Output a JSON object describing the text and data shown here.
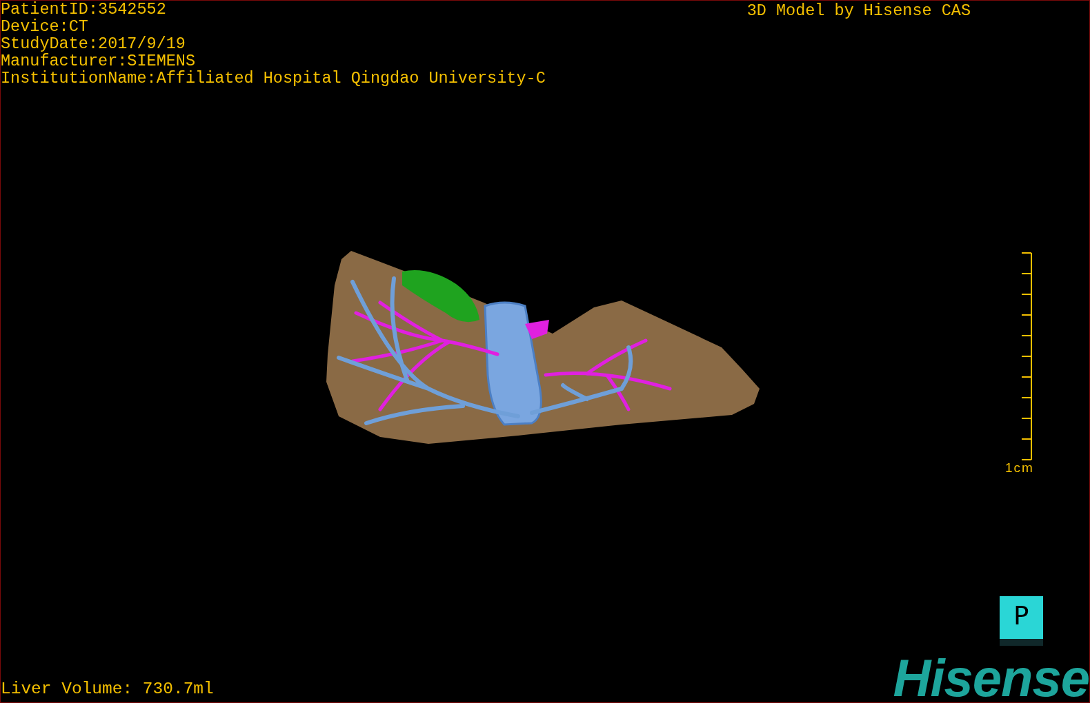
{
  "overlay": {
    "info_lines": [
      "PatientID:3542552",
      "Device:CT",
      "StudyDate:2017/9/19",
      "Manufacturer:SIEMENS",
      "InstitutionName:Affiliated Hospital Qingdao University-C"
    ],
    "title": "3D Model by Hisense CAS"
  },
  "scale_bar": {
    "label": "1cm"
  },
  "orientation_cube": {
    "label": "P"
  },
  "measurement": "Liver Volume: 730.7ml",
  "logo": "Hisense"
}
